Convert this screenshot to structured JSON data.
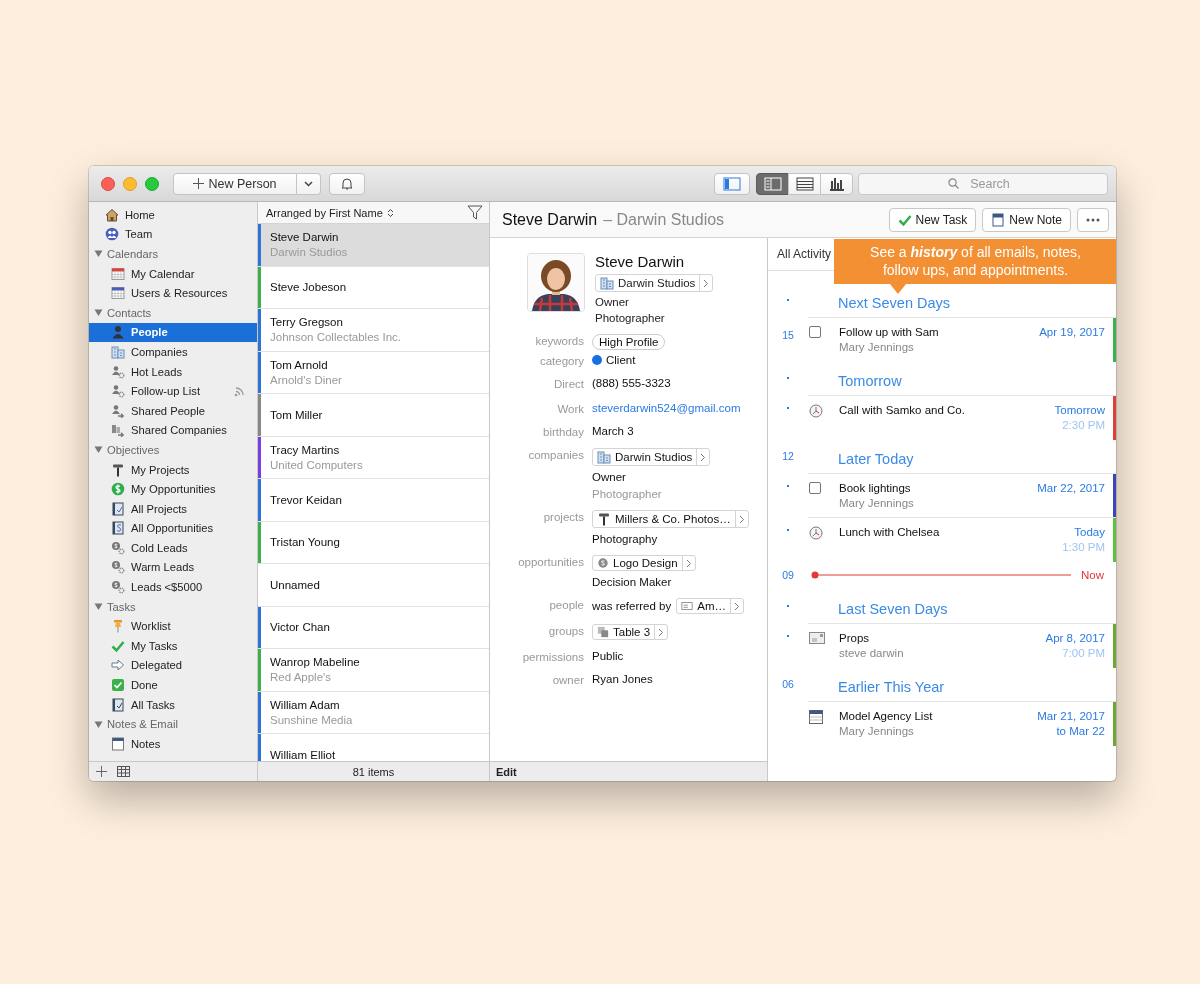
{
  "toolbar": {
    "new_button": "New Person",
    "sidebar_toggle": {
      "on": true
    },
    "views": [
      {
        "kind": "detail",
        "selected": true
      },
      {
        "kind": "list",
        "selected": false
      },
      {
        "kind": "chart",
        "selected": false
      }
    ],
    "search": {
      "placeholder": "Search"
    }
  },
  "sidebar": {
    "items": [
      {
        "label": "Home",
        "selected": false,
        "shared": false
      },
      {
        "label": "Team",
        "selected": false,
        "shared": false
      }
    ],
    "groups": [
      {
        "title": "Calendars",
        "expanded": true,
        "items": [
          {
            "label": "My Calendar",
            "selected": false,
            "shared": false
          },
          {
            "label": "Users & Resources",
            "selected": false,
            "shared": false
          }
        ]
      },
      {
        "title": "Contacts",
        "expanded": true,
        "items": [
          {
            "label": "People",
            "selected": true,
            "shared": false
          },
          {
            "label": "Companies",
            "selected": false,
            "shared": false
          },
          {
            "label": "Hot Leads",
            "selected": false,
            "shared": false
          },
          {
            "label": "Follow-up List",
            "selected": false,
            "shared": true
          },
          {
            "label": "Shared People",
            "selected": false,
            "shared": false
          },
          {
            "label": "Shared Companies",
            "selected": false,
            "shared": false
          }
        ]
      },
      {
        "title": "Objectives",
        "expanded": true,
        "items": [
          {
            "label": "My Projects",
            "selected": false,
            "shared": false
          },
          {
            "label": "My Opportunities",
            "selected": false,
            "shared": false
          },
          {
            "label": "All Projects",
            "selected": false,
            "shared": false
          },
          {
            "label": "All Opportunities",
            "selected": false,
            "shared": false
          },
          {
            "label": "Cold Leads",
            "selected": false,
            "shared": false
          },
          {
            "label": "Warm Leads",
            "selected": false,
            "shared": false
          },
          {
            "label": "Leads <$5000",
            "selected": false,
            "shared": false
          }
        ]
      },
      {
        "title": "Tasks",
        "expanded": true,
        "items": [
          {
            "label": "Worklist",
            "selected": false,
            "shared": false
          },
          {
            "label": "My Tasks",
            "selected": false,
            "shared": false
          },
          {
            "label": "Delegated",
            "selected": false,
            "shared": false
          },
          {
            "label": "Done",
            "selected": false,
            "shared": false
          },
          {
            "label": "All Tasks",
            "selected": false,
            "shared": false
          }
        ]
      },
      {
        "title": "Notes & Email",
        "expanded": true,
        "items": [
          {
            "label": "Notes",
            "selected": false,
            "shared": false
          }
        ]
      }
    ]
  },
  "list": {
    "sort_label": "Arranged by First Name",
    "rows": [
      {
        "name": "Steve Darwin",
        "company": "Darwin Studios",
        "color": "#2f72d8",
        "selected": true
      },
      {
        "name": "Steve Jobeson",
        "color": "#3cb04a",
        "selected": false
      },
      {
        "name": "Terry Gregson",
        "company": "Johnson Collectables Inc.",
        "color": "#2f72d8",
        "selected": false
      },
      {
        "name": "Tom Arnold",
        "company": "Arnold's Diner",
        "color": "#2f72d8",
        "selected": false
      },
      {
        "name": "Tom Miller",
        "color": "#888888",
        "selected": false
      },
      {
        "name": "Tracy Martins",
        "company": "United Computers",
        "color": "#7b3fe0",
        "selected": false
      },
      {
        "name": "Trevor Keidan",
        "color": "#2f72d8",
        "selected": false
      },
      {
        "name": "Tristan Young",
        "color": "#3cb04a",
        "selected": false
      },
      {
        "name": "Unnamed",
        "selected": false
      },
      {
        "name": "Victor Chan",
        "color": "#2f72d8",
        "selected": false
      },
      {
        "name": "Wanrop Mabeline",
        "company": "Red Apple's",
        "color": "#3cb04a",
        "selected": false
      },
      {
        "name": "William Adam",
        "company": "Sunshine Media",
        "color": "#2f72d8",
        "selected": false
      },
      {
        "name": "William Elliot",
        "color": "#2f72d8",
        "selected": false
      }
    ],
    "footer": "81 items"
  },
  "header": {
    "title": "Steve Darwin",
    "subtitle": "– Darwin Studios",
    "buttons": [
      {
        "label": "New Task"
      },
      {
        "label": "New Note"
      }
    ]
  },
  "detail": {
    "name": "Steve Darwin",
    "company": "Darwin Studios",
    "title": "Owner",
    "role": "Photographer",
    "fields": [
      {
        "label": "keywords",
        "kind": "pill",
        "value": "High Profile"
      },
      {
        "label": "category",
        "kind": "category",
        "value": "Client",
        "color": "#1a6fe0"
      },
      {
        "label": "Direct",
        "kind": "text",
        "value": "(888) 555-3323"
      },
      {
        "label": "Work",
        "kind": "link",
        "value": "steverdarwin524@gmail.com"
      },
      {
        "label": "birthday",
        "kind": "text",
        "value": "March  3"
      },
      {
        "label": "companies",
        "kind": "chip",
        "value": "Darwin Studios",
        "lines": [
          {
            "text": "Owner",
            "muted": false
          },
          {
            "text": "Photographer",
            "muted": true
          }
        ]
      },
      {
        "label": "projects",
        "kind": "chip",
        "value": "Millers & Co. Photos…",
        "lines": [
          {
            "text": "Photography",
            "muted": false
          }
        ]
      },
      {
        "label": "opportunities",
        "kind": "chip",
        "value": "Logo Design",
        "lines": [
          {
            "text": "Decision Maker",
            "muted": false
          }
        ]
      },
      {
        "label": "people",
        "kind": "chip",
        "prefix": "was referred by",
        "value": "Am…"
      },
      {
        "label": "groups",
        "kind": "chip",
        "value": "Table 3"
      },
      {
        "label": "permissions",
        "kind": "text",
        "value": "Public"
      },
      {
        "label": "owner",
        "kind": "text",
        "value": "Ryan Jones"
      }
    ],
    "footer": "Edit"
  },
  "activity": {
    "filter": "All Activity",
    "callout": "See a **history** of all emails, notes, follow ups, and appointments.",
    "entries": [
      {
        "kind": "heading",
        "title": "Next Seven Days"
      },
      {
        "kind": "task",
        "title": "Follow up with Sam",
        "subtitle": "Mary Jennings",
        "date": "Apr 19, 2017",
        "checked": false,
        "color": "#3cb04a",
        "ruler": "15"
      },
      {
        "kind": "heading",
        "title": "Tomorrow"
      },
      {
        "kind": "event",
        "title": "Call with Samko and Co.",
        "date": "Tomorrow",
        "time": "2:30 PM",
        "color": "#e0403c"
      },
      {
        "kind": "heading",
        "title": "Later Today",
        "ruler": "12"
      },
      {
        "kind": "task",
        "title": "Book lightings",
        "subtitle": "Mary Jennings",
        "date": "Mar 22, 2017",
        "checked": false,
        "color": "#3a45b8"
      },
      {
        "kind": "event",
        "title": "Lunch with Chelsea",
        "date": "Today",
        "time": "1:30 PM",
        "color": "#5cc040"
      },
      {
        "kind": "now",
        "title": "Now",
        "ruler": "09"
      },
      {
        "kind": "heading",
        "title": "Last Seven Days"
      },
      {
        "kind": "note",
        "title": "Props",
        "subtitle": "steve darwin",
        "date": "Apr 8, 2017",
        "time": "7:00 PM",
        "color": "#6aaa30"
      },
      {
        "kind": "heading",
        "title": "Earlier This Year",
        "ruler": "06"
      },
      {
        "kind": "list",
        "title": "Model Agency List",
        "subtitle": "Mary Jennings",
        "date": "Mar 21, 2017",
        "time": "to Mar 22",
        "color": "#6aaa30"
      }
    ]
  }
}
